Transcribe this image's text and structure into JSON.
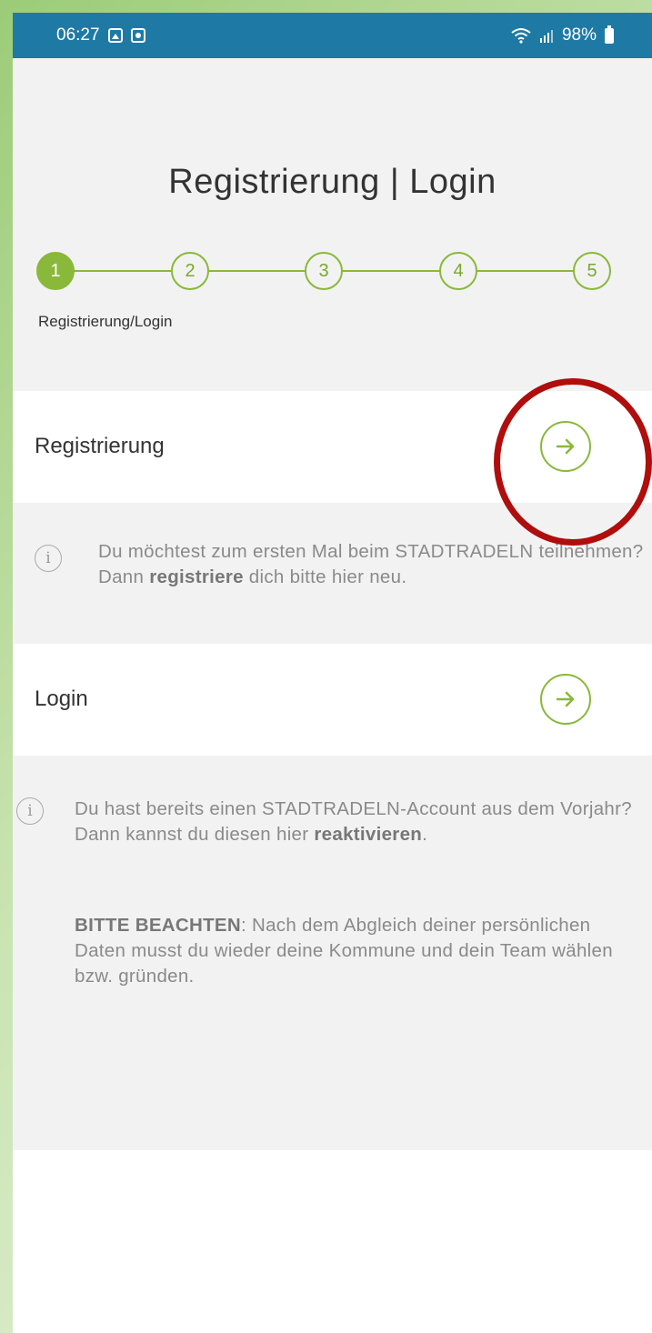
{
  "status_bar": {
    "time": "06:27",
    "battery": "98%",
    "icons": [
      "gallery-icon",
      "record-icon",
      "wifi-icon",
      "signal-icon",
      "battery-icon"
    ]
  },
  "page": {
    "title": "Registrierung | Login"
  },
  "stepper": {
    "steps": [
      "1",
      "2",
      "3",
      "4",
      "5"
    ],
    "active_step": "1",
    "active_label": "Registrierung/Login"
  },
  "registration": {
    "label": "Registrierung",
    "info_pre": "Du möchtest zum ersten Mal beim STADTRADELN teilnehmen? Dann ",
    "info_bold": "registriere",
    "info_post": " dich bitte hier neu."
  },
  "login": {
    "label": "Login",
    "info1_pre": "Du hast bereits einen STADTRADELN-Account aus dem Vorjahr? Dann kannst du diesen hier ",
    "info1_bold": "reaktivieren",
    "info1_post": ".",
    "info2_bold": "BITTE BEACHTEN",
    "info2_post": ": Nach dem Abgleich deiner persönlichen Daten musst du wieder deine Kommune und dein Team wählen bzw. gründen."
  },
  "colors": {
    "accent": "#8ab83a",
    "status_bar": "#1e7aa5",
    "highlight_ring": "#b00d0d"
  }
}
